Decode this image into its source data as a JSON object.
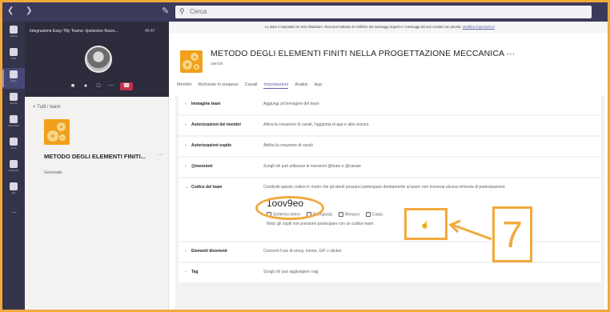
{
  "titlebar": {
    "search_placeholder": "Cerca"
  },
  "rail": {
    "items": [
      {
        "label": "Attività"
      },
      {
        "label": "Chat"
      },
      {
        "label": "Team"
      },
      {
        "label": "Attività"
      },
      {
        "label": "Calendario"
      },
      {
        "label": "Turni"
      },
      {
        "label": "Chiamate"
      },
      {
        "label": "File"
      },
      {
        "label": "..."
      }
    ]
  },
  "call": {
    "title": "Integrazione Easy-Tilly Teams: ripetizione flusso...",
    "time": "45:47"
  },
  "left_panel": {
    "back_label": "< Tutti i team",
    "team_name": "METODO DEGLI ELEMENTI FINITI...",
    "more": "···",
    "channel": "Generale"
  },
  "banner": {
    "text": "Lo stato è impostato su Non disturbare. Riceverai soltanto le notifiche dei messaggi urgenti e i messaggi dei tuoi contatti con priorità.",
    "link": "Modifica impostazioni"
  },
  "header": {
    "title": "METODO DEGLI ELEMENTI FINITI NELLA PROGETTAZIONE MECCANICA ···",
    "subtitle": "168729"
  },
  "tabs": [
    {
      "label": "Membri"
    },
    {
      "label": "Richieste in sospeso"
    },
    {
      "label": "Canali"
    },
    {
      "label": "Impostazioni",
      "active": true
    },
    {
      "label": "Analisi"
    },
    {
      "label": "App"
    }
  ],
  "settings": {
    "rows": [
      {
        "title": "Immagine team",
        "desc": "Aggiungi un'immagine del team"
      },
      {
        "title": "Autorizzazioni dei membri",
        "desc": "Attiva la creazione di canali, l'aggiunta di app e altro ancora"
      },
      {
        "title": "Autorizzazioni ospite",
        "desc": "Abilita la creazione di canali"
      },
      {
        "title": "@menzioni",
        "desc": "Scegli chi può utilizzare le menzioni @team e @canale"
      },
      {
        "title": "Codice del team",
        "desc": "Condividi questo codice in modo che gli utenti possano partecipare direttamente al team; non riceverai alcuna richiesta di partecipazione"
      },
      {
        "title": "Elementi divertenti",
        "desc": "Consenti l'uso di emoji, meme, GIF o sticker"
      },
      {
        "title": "Tag",
        "desc": "Scegli chi può aggiungere i tag"
      }
    ],
    "team_code": "1oov9eo",
    "actions": [
      "Schermo intero",
      "Reimposta",
      "Rimuovi",
      "Copia"
    ],
    "note": "Nota: gli ospiti non potranno partecipare con un codice team"
  },
  "overlay": {
    "step_number": "7"
  },
  "colors": {
    "accent": "#6264a7",
    "highlight": "#f2a93b",
    "rail": "#33344a"
  }
}
